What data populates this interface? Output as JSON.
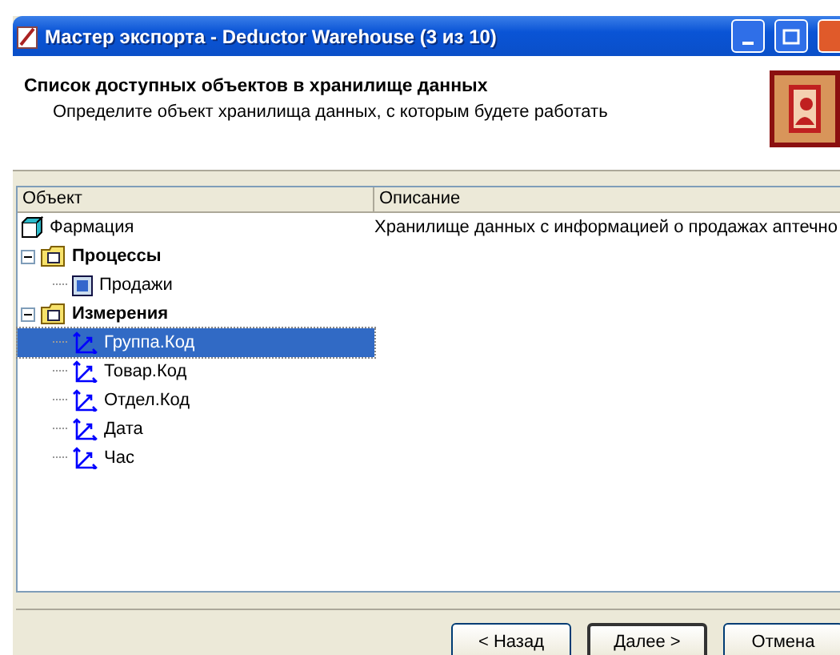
{
  "window": {
    "title": "Мастер экспорта - Deductor Warehouse (3 из 10)"
  },
  "header": {
    "title": "Список доступных объектов в хранилище данных",
    "subtitle": "Определите объект хранилища данных, с которым будете работать"
  },
  "table": {
    "columns": [
      "Объект",
      "Описание"
    ],
    "rows": [
      {
        "kind": "warehouse",
        "label": "Фармация",
        "description": "Хранилище данных с информацией о продажах аптечно",
        "selected": false
      },
      {
        "kind": "folder",
        "label": "Процессы",
        "expanded": true,
        "selected": false,
        "children": [
          {
            "kind": "process",
            "label": "Продажи",
            "selected": false
          }
        ]
      },
      {
        "kind": "folder",
        "label": "Измерения",
        "expanded": true,
        "selected": false,
        "children": [
          {
            "kind": "dimension",
            "label": "Группа.Код",
            "selected": true
          },
          {
            "kind": "dimension",
            "label": "Товар.Код",
            "selected": false
          },
          {
            "kind": "dimension",
            "label": "Отдел.Код",
            "selected": false
          },
          {
            "kind": "dimension",
            "label": "Дата",
            "selected": false
          },
          {
            "kind": "dimension",
            "label": "Час",
            "selected": false
          }
        ]
      }
    ]
  },
  "buttons": [
    {
      "label": "< Назад",
      "default": false
    },
    {
      "label": "Далее >",
      "default": true
    },
    {
      "label": "Отмена",
      "default": false
    }
  ]
}
